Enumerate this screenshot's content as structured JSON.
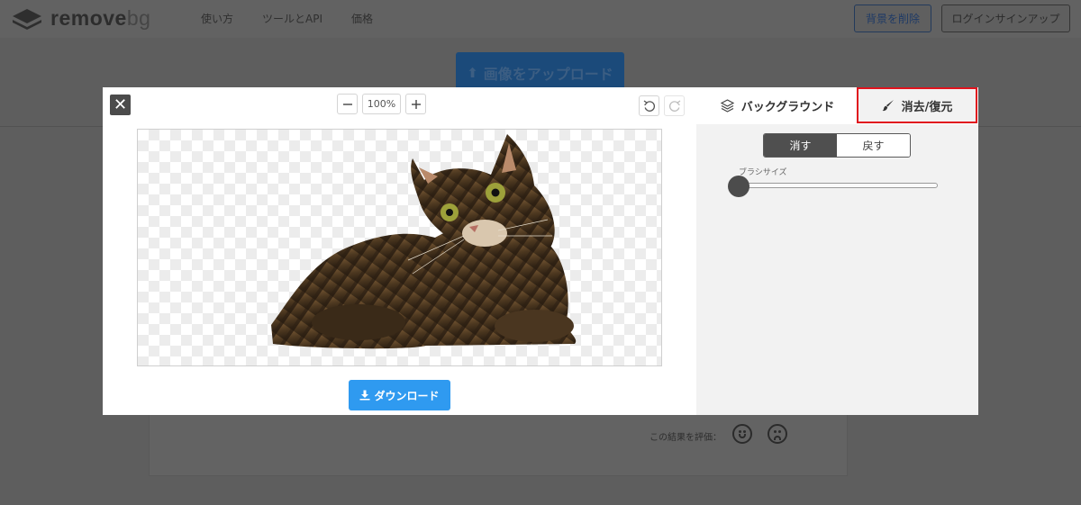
{
  "header": {
    "logo_text": "remove",
    "logo_suffix": "bg",
    "nav": [
      "使い方",
      "ツールとAPI",
      "価格"
    ],
    "remove_bg_button": "背景を削除",
    "login_button": "ログインサインアップ"
  },
  "upload_button": "画像をアップロード",
  "rating": {
    "label": "この結果を評価："
  },
  "editor": {
    "zoom_level": "100%",
    "download_label": "ダウンロード",
    "tabs": {
      "background": "バックグラウンド",
      "erase_restore": "消去/復元"
    },
    "mode": {
      "erase": "消す",
      "restore": "戻す",
      "active": "erase"
    },
    "brush_size_label": "ブラシサイズ",
    "brush_size": 0
  },
  "colors": {
    "highlight": "#e0141e",
    "download_button": "#2f9af0",
    "active_segment": "#4f4f4f"
  }
}
